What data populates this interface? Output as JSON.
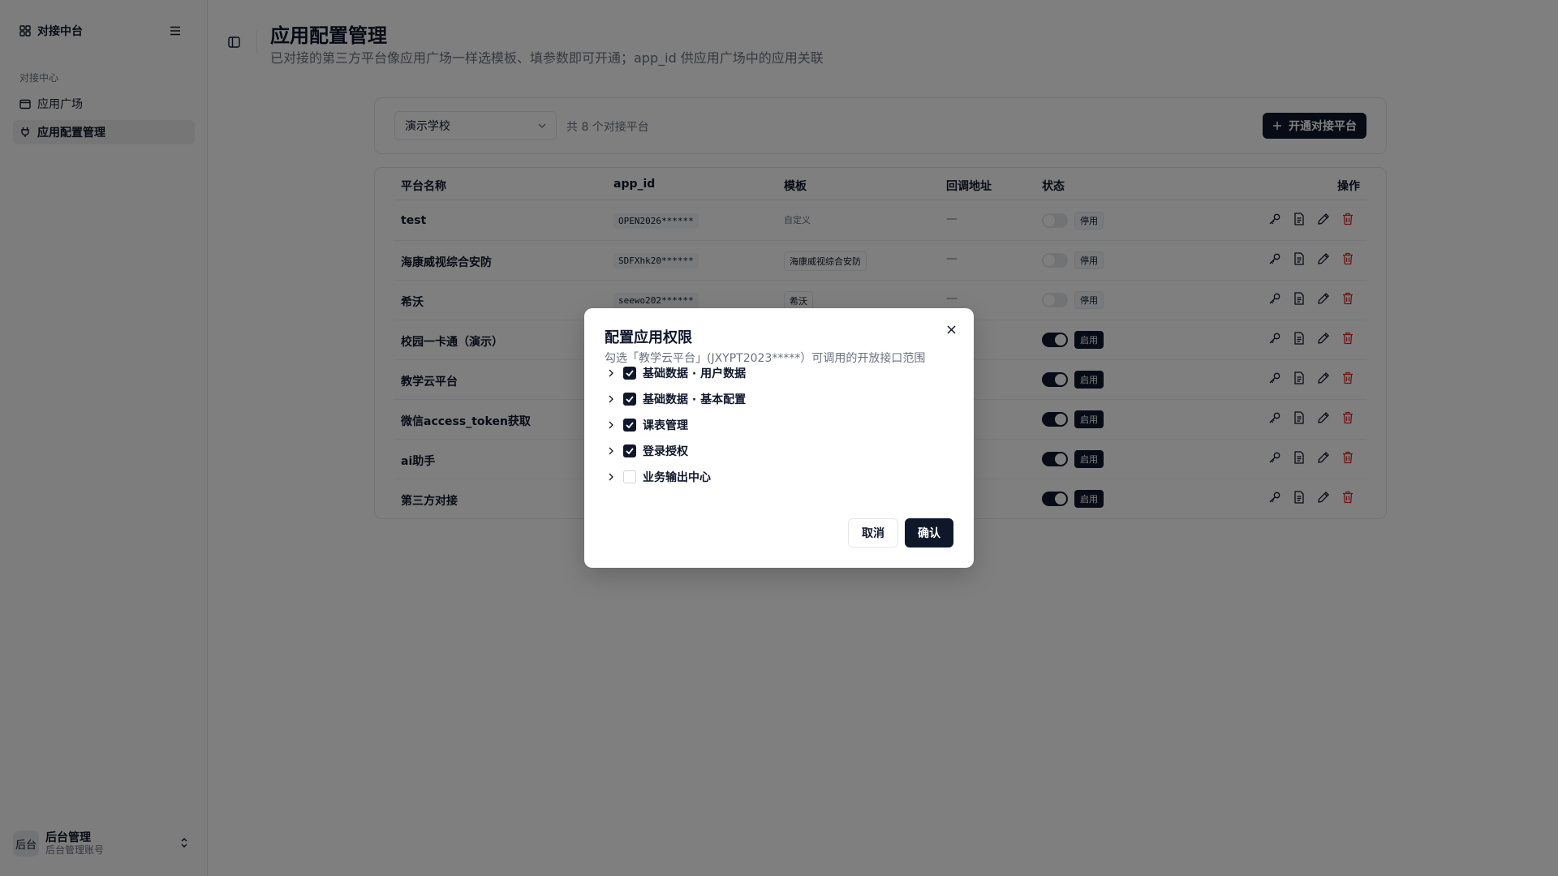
{
  "sidebar": {
    "brand": "对接中台",
    "section_label": "对接中心",
    "items": [
      {
        "label": "应用广场"
      },
      {
        "label": "应用配置管理"
      }
    ],
    "user": {
      "avatar": "后台",
      "name": "后台管理",
      "sub": "后台管理账号"
    }
  },
  "header": {
    "title": "应用配置管理",
    "description": "已对接的第三方平台像应用广场一样选模板、填参数即可开通；app_id 供应用广场中的应用关联"
  },
  "toolbar": {
    "school_selected": "演示学校",
    "count_text": "共 8 个对接平台",
    "add_button": "开通对接平台"
  },
  "table": {
    "columns": [
      "平台名称",
      "app_id",
      "模板",
      "回调地址",
      "状态",
      "操作"
    ],
    "rows": [
      {
        "name": "test",
        "app_id": "OPEN2026******",
        "template": "自定义",
        "callback": "—",
        "status": "停用"
      },
      {
        "name": "海康威视综合安防",
        "app_id": "SDFXhk20******",
        "template": "海康威视综合安防",
        "callback": "—",
        "status": "停用"
      },
      {
        "name": "希沃",
        "app_id": "seewo202******",
        "template": "希沃",
        "callback": "—",
        "status": "停用"
      },
      {
        "name": "校园一卡通（演示）",
        "status": "启用"
      },
      {
        "name": "教学云平台",
        "status": "启用"
      },
      {
        "name": "微信access_token获取",
        "status": "启用"
      },
      {
        "name": "ai助手",
        "status": "启用"
      },
      {
        "name": "第三方对接",
        "status": "启用"
      }
    ]
  },
  "dialog": {
    "title": "配置应用权限",
    "description": "勾选「教学云平台」(JXYPT2023*****）可调用的开放接口范围",
    "permissions": [
      {
        "label": "基础数据 · 用户数据",
        "checked": true
      },
      {
        "label": "基础数据 · 基本配置",
        "checked": true
      },
      {
        "label": "课表管理",
        "checked": true
      },
      {
        "label": "登录授权",
        "checked": true
      },
      {
        "label": "业务输出中心",
        "checked": false
      }
    ],
    "cancel": "取消",
    "confirm": "确认"
  },
  "colors": {
    "primary": "#0f172a",
    "danger": "#dc2626",
    "muted": "#6b7280"
  },
  "icons": [
    "grid-icon",
    "menu-icon",
    "window-icon",
    "plug-icon",
    "sidebar-toggle-icon",
    "chevron-down-icon",
    "plus-icon",
    "key-icon",
    "document-icon",
    "pencil-icon",
    "trash-icon",
    "close-icon",
    "chevron-right-icon",
    "check-icon",
    "chevron-up-down-icon"
  ]
}
